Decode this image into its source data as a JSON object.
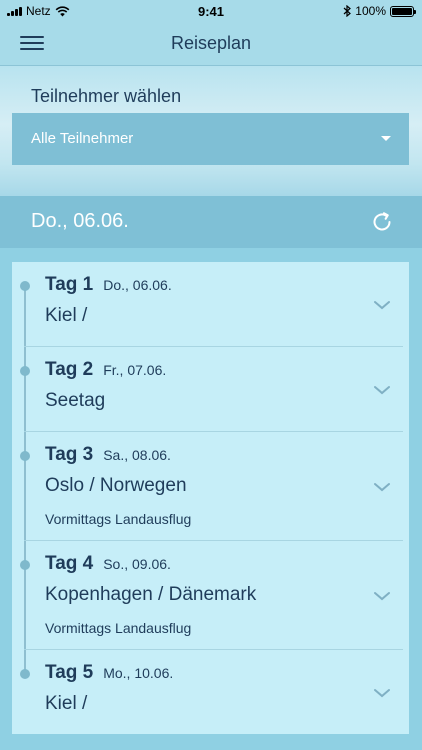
{
  "status_bar": {
    "carrier": "Netz",
    "time": "9:41",
    "battery": "100%",
    "battery_level": 1.0
  },
  "header": {
    "title": "Reiseplan",
    "menu_icon": "hamburger-menu-icon"
  },
  "participants": {
    "label": "Teilnehmer wählen",
    "selected": "Alle Teilnehmer"
  },
  "current_date": {
    "label": "Do., 06.06.",
    "refresh_icon": "refresh-icon"
  },
  "days": [
    {
      "day": "Tag 1",
      "date": "Do., 06.06.",
      "place": "Kiel /",
      "excursion": ""
    },
    {
      "day": "Tag 2",
      "date": "Fr., 07.06.",
      "place": "Seetag",
      "excursion": ""
    },
    {
      "day": "Tag 3",
      "date": "Sa., 08.06.",
      "place": "Oslo / Norwegen",
      "excursion": "Vormittags Landausflug"
    },
    {
      "day": "Tag 4",
      "date": "So., 09.06.",
      "place": "Kopenhagen / Dänemark",
      "excursion": "Vormittags Landausflug"
    },
    {
      "day": "Tag 5",
      "date": "Mo., 10.06.",
      "place": "Kiel /",
      "excursion": ""
    }
  ],
  "colors": {
    "accent": "#7fc0d6",
    "text": "#1f3c5a",
    "list_background": "#c6eef8"
  }
}
